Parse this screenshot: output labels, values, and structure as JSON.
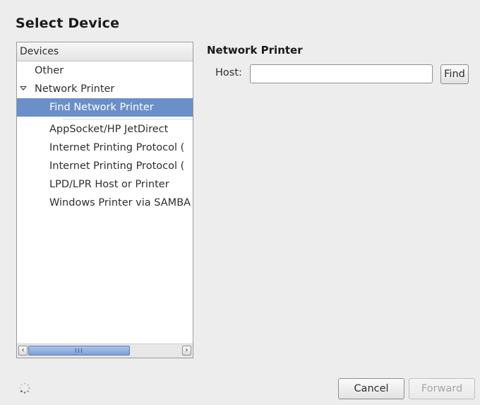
{
  "dialog": {
    "title": "Select Device"
  },
  "device_list": {
    "header": "Devices",
    "items": [
      {
        "label": "Other",
        "level": 0,
        "selected": false
      },
      {
        "label": "Network Printer",
        "level": 0,
        "expanded": true,
        "selected": false
      },
      {
        "label": "Find Network Printer",
        "level": 1,
        "selected": true
      },
      {
        "label": "AppSocket/HP JetDirect",
        "level": 1,
        "selected": false
      },
      {
        "label": "Internet Printing Protocol (",
        "level": 1,
        "selected": false
      },
      {
        "label": "Internet Printing Protocol (",
        "level": 1,
        "selected": false
      },
      {
        "label": "LPD/LPR Host or Printer",
        "level": 1,
        "selected": false
      },
      {
        "label": "Windows Printer via SAMBA",
        "level": 1,
        "selected": false
      }
    ],
    "scrollbar": {
      "left_arrow": "‹",
      "right_arrow": "›"
    }
  },
  "network_printer": {
    "section_title": "Network Printer",
    "host_label": "Host:",
    "host_value": "",
    "find_label": "Find"
  },
  "footer": {
    "cancel_label": "Cancel",
    "forward_label": "Forward",
    "spinner_icon": "busy-spinner-icon"
  },
  "colors": {
    "selection": "#6b8fc9",
    "background": "#ededed"
  }
}
